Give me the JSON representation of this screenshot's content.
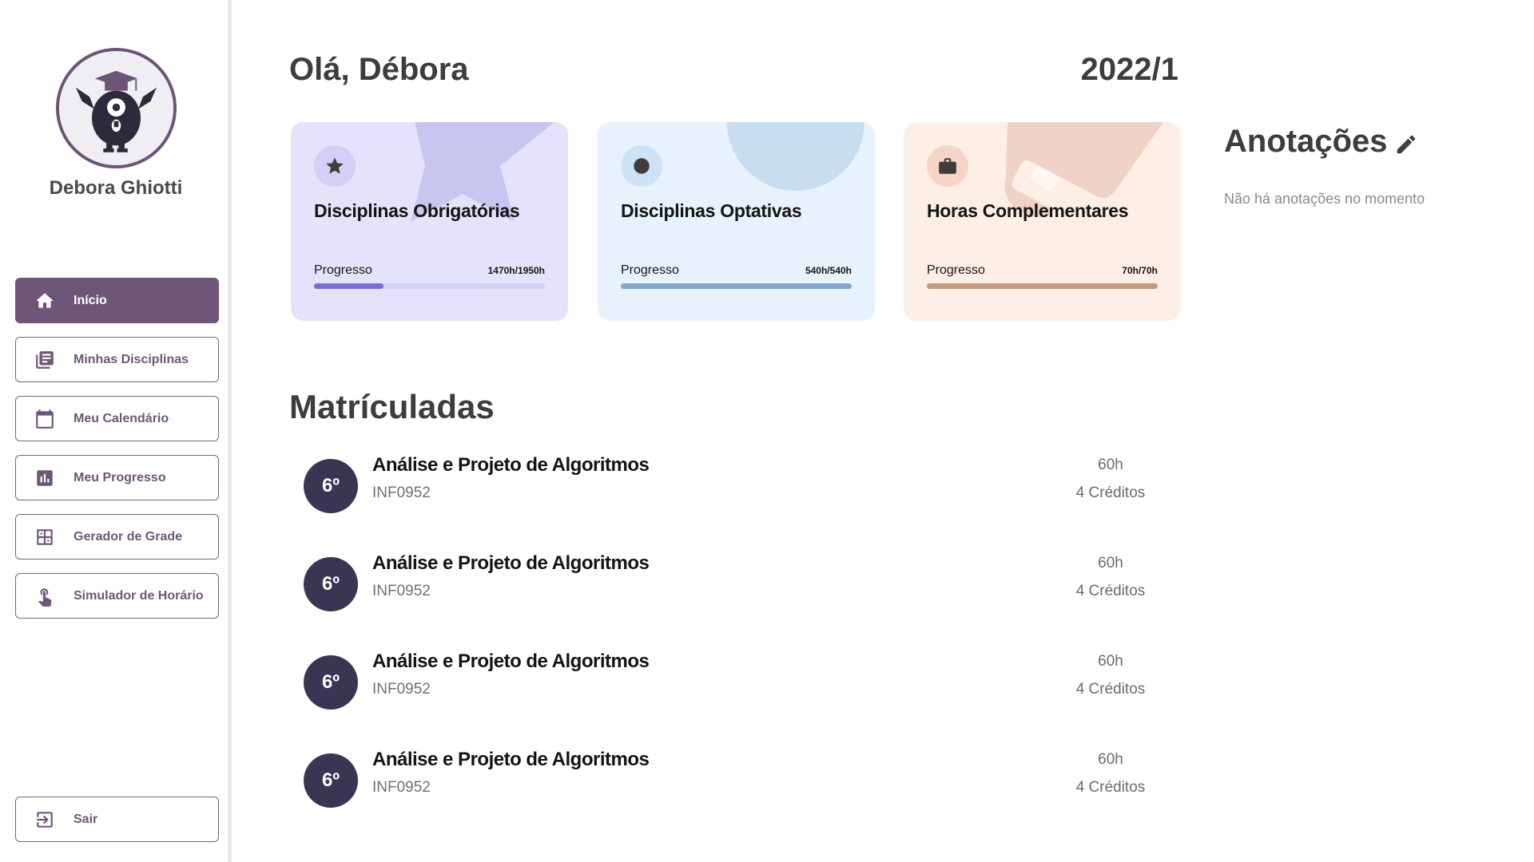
{
  "user": {
    "name": "Debora Ghiotti"
  },
  "nav": {
    "items": [
      {
        "label": "Início",
        "icon": "home-icon",
        "active": true
      },
      {
        "label": "Minhas Disciplinas",
        "icon": "library-books-icon",
        "active": false
      },
      {
        "label": "Meu Calendário",
        "icon": "calendar-icon",
        "active": false
      },
      {
        "label": "Meu Progresso",
        "icon": "bar-chart-icon",
        "active": false
      },
      {
        "label": "Gerador de Grade",
        "icon": "grid-view-icon",
        "active": false
      },
      {
        "label": "Simulador de Horário",
        "icon": "touch-icon",
        "active": false
      }
    ],
    "logout": {
      "label": "Sair",
      "icon": "logout-icon"
    }
  },
  "header": {
    "greeting": "Olá, Débora",
    "semester": "2022/1"
  },
  "cards": [
    {
      "title": "Disciplinas Obrigatórias",
      "icon": "star-icon",
      "progress_label": "Progresso",
      "progress_text": "1470h/1950h",
      "progress": 0.3,
      "bg": "#e4e3fb",
      "accent": "#7b6fd6",
      "track": "#cfd1f6",
      "deco": "#c8c5f0",
      "icon_bg": "#d3cff5"
    },
    {
      "title": "Disciplinas Optativas",
      "icon": "circle-icon",
      "progress_label": "Progresso",
      "progress_text": "540h/540h",
      "progress": 1.0,
      "bg": "#e7f2fd",
      "accent": "#7fa8cf",
      "track": "#cfe1f3",
      "deco": "#c9ddf1",
      "icon_bg": "#cfe3f6"
    },
    {
      "title": "Horas Complementares",
      "icon": "briefcase-icon",
      "progress_label": "Progresso",
      "progress_text": "70h/70h",
      "progress": 1.0,
      "bg": "#fdeee6",
      "accent": "#c59a7c",
      "track": "#f1d6c6",
      "deco": "#f1d2c6",
      "icon_bg": "#f6d5c8"
    }
  ],
  "notes": {
    "title": "Anotações",
    "empty": "Não há anotações no momento"
  },
  "enrolled": {
    "title": "Matrículadas",
    "items": [
      {
        "semester": "6º",
        "name": "Análise e Projeto de Algoritmos",
        "code": "INF0952",
        "hours": "60h",
        "credits": "4 Créditos"
      },
      {
        "semester": "6º",
        "name": "Análise e Projeto de Algoritmos",
        "code": "INF0952",
        "hours": "60h",
        "credits": "4 Créditos"
      },
      {
        "semester": "6º",
        "name": "Análise e Projeto de Algoritmos",
        "code": "INF0952",
        "hours": "60h",
        "credits": "4 Créditos"
      },
      {
        "semester": "6º",
        "name": "Análise e Projeto de Algoritmos",
        "code": "INF0952",
        "hours": "60h",
        "credits": "4 Créditos"
      }
    ]
  }
}
